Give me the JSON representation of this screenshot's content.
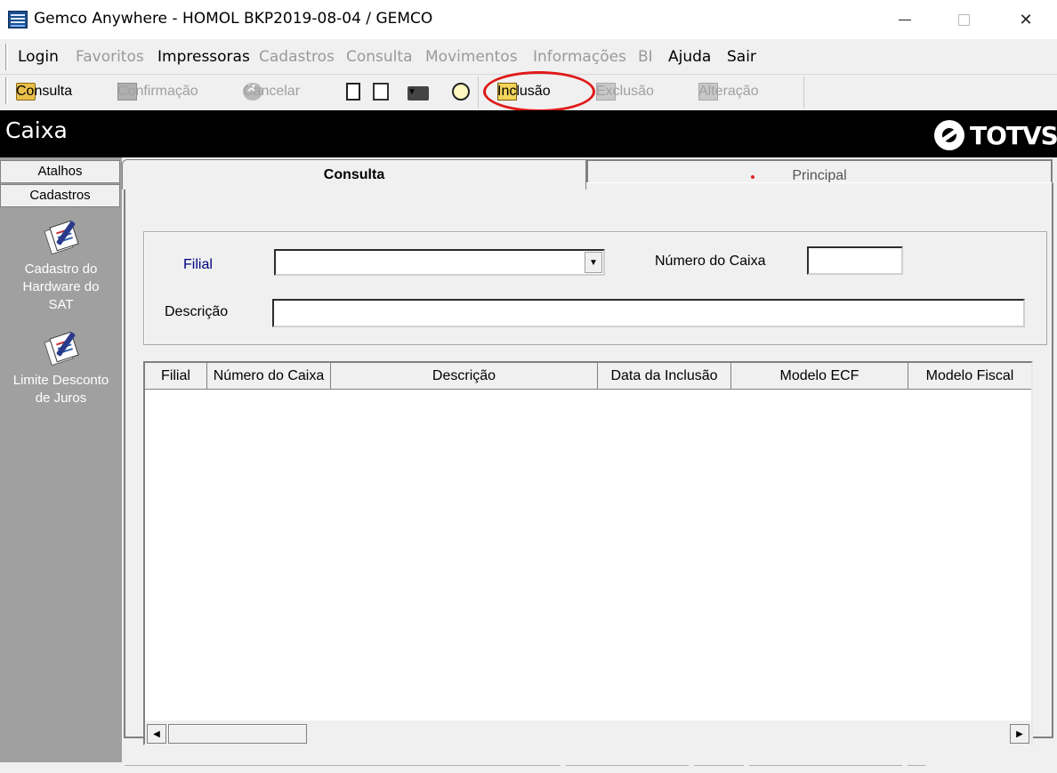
{
  "window": {
    "title": "Gemco Anywhere - HOMOL BKP2019-08-04 / GEMCO",
    "minimize_glyph": "—",
    "close_glyph": "✕"
  },
  "menubar": {
    "items": [
      {
        "label": "Login",
        "enabled": true
      },
      {
        "label": "Favoritos",
        "enabled": false
      },
      {
        "label": "Impressoras",
        "enabled": true
      },
      {
        "label": "Cadastros",
        "enabled": false
      },
      {
        "label": "Consulta",
        "enabled": false
      },
      {
        "label": "Movimentos",
        "enabled": false
      },
      {
        "label": "Informações",
        "enabled": false
      },
      {
        "label": "BI",
        "enabled": false
      },
      {
        "label": "Ajuda",
        "enabled": true
      },
      {
        "label": "Sair",
        "enabled": true
      }
    ]
  },
  "toolbar": {
    "consulta": {
      "label": "Consulta",
      "icon": "folder-search-icon",
      "enabled": true
    },
    "confirmacao": {
      "label": "Confirmação",
      "icon": "save-icon",
      "enabled": false
    },
    "cancelar": {
      "label": "Cancelar",
      "icon": "cancel-icon",
      "enabled": false
    },
    "inclusao": {
      "label": "Inclusão",
      "icon": "add-record-icon",
      "enabled": true,
      "highlighted": true
    },
    "exclusao": {
      "label": "Exclusão",
      "icon": "delete-record-icon",
      "enabled": false
    },
    "alteracao": {
      "label": "Alteração",
      "icon": "edit-record-icon",
      "enabled": false
    },
    "annotation_color": "#e01818"
  },
  "header": {
    "title": "Caixa",
    "brand": "TOTVS"
  },
  "sidebar": {
    "tabs": [
      "Atalhos",
      "Cadastros"
    ],
    "items": [
      {
        "label_lines": [
          "Cadastro do",
          "Hardware do",
          "SAT"
        ],
        "icon": "notepad-pen-icon"
      },
      {
        "label_lines": [
          "Limite Desconto",
          "de Juros"
        ],
        "icon": "notepad-pen-icon"
      }
    ]
  },
  "tabs": {
    "active": "Consulta",
    "inactive": "Principal"
  },
  "filters": {
    "filial_label": "Filial",
    "filial_value": "",
    "numero_label": "Número do Caixa",
    "numero_value": "",
    "descricao_label": "Descrição",
    "descricao_value": ""
  },
  "grid": {
    "columns": [
      "Filial",
      "Número do Caixa",
      "Descrição",
      "Data da Inclusão",
      "Modelo ECF",
      "Modelo Fiscal"
    ],
    "rows": []
  },
  "colors": {
    "header_bg": "#000000",
    "sidebar_bg": "#a0a0a0",
    "filial_label": "#000080"
  }
}
